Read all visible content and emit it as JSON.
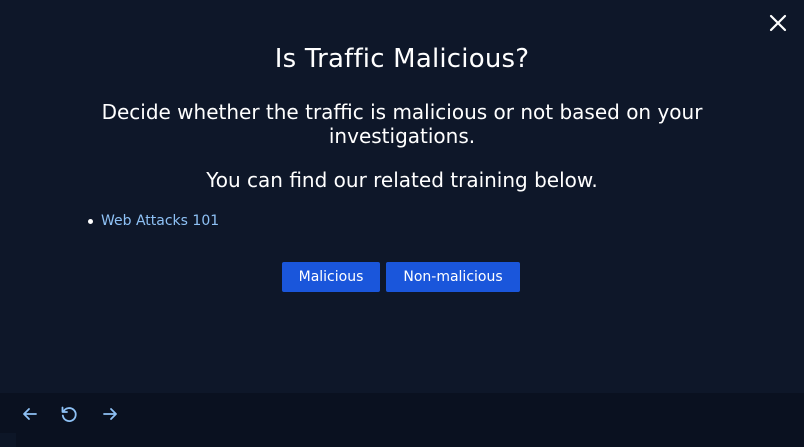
{
  "dialog": {
    "title": "Is Traffic Malicious?",
    "description": "Decide whether the traffic is malicious or not based on your investigations.",
    "hint": "You can find our related training below.",
    "trainings": [
      {
        "label": "Web Attacks 101"
      }
    ],
    "buttons": {
      "malicious_label": "Malicious",
      "non_malicious_label": "Non-malicious"
    },
    "close_icon": "close-icon"
  },
  "footer": {
    "icons": [
      "arrow-left-icon",
      "refresh-icon",
      "arrow-right-icon"
    ]
  },
  "colors": {
    "background": "#0e1729",
    "footer": "#0a1120",
    "button": "#1a56db",
    "link": "#8ec1f5"
  }
}
